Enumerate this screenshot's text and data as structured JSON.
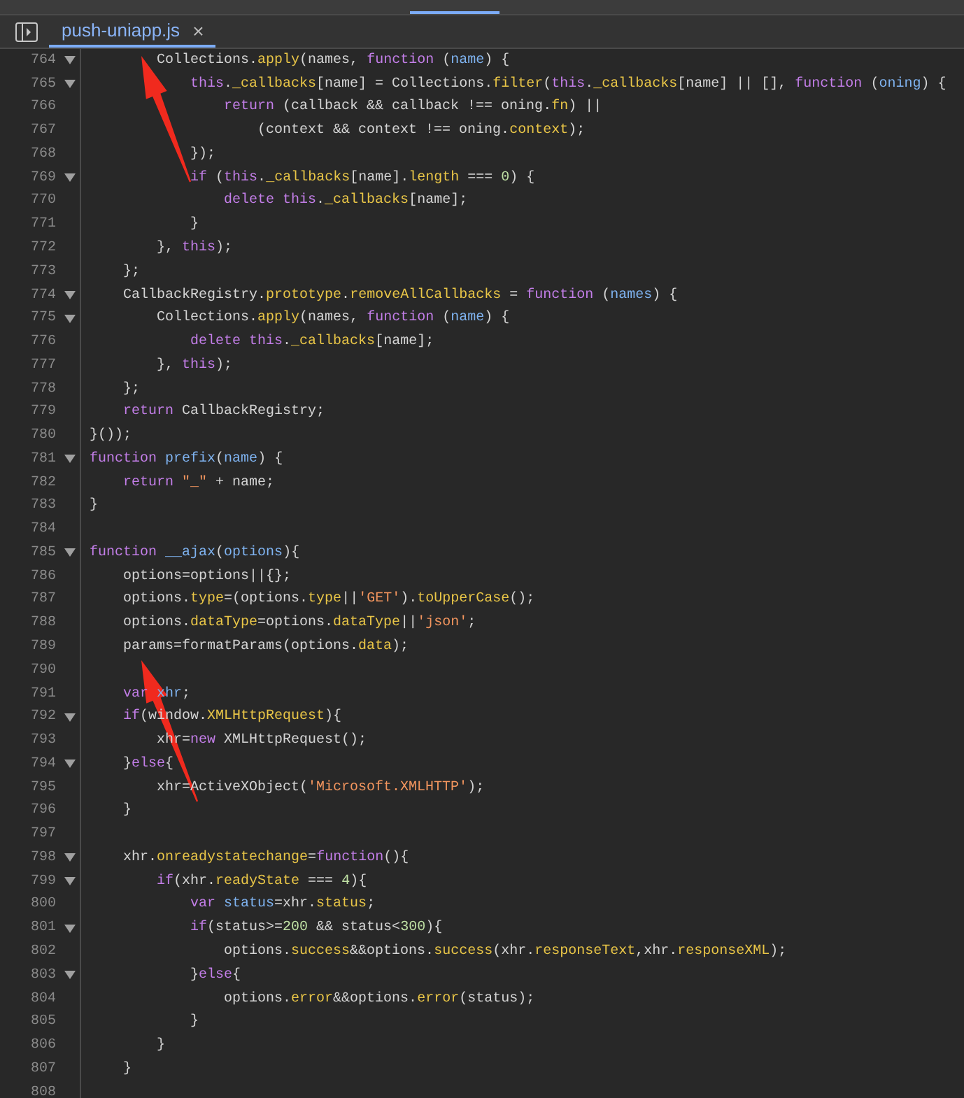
{
  "file_tab": {
    "label": "push-uniapp.js",
    "close": "×",
    "selected": true
  },
  "lines": [
    {
      "number": "764",
      "foldable": true,
      "tokens": [
        {
          "kind": "plain",
          "text": "        Collections."
        },
        {
          "kind": "property",
          "text": "apply"
        },
        {
          "kind": "plain",
          "text": "(names, "
        },
        {
          "kind": "keyword",
          "text": "function"
        },
        {
          "kind": "plain",
          "text": " ("
        },
        {
          "kind": "name",
          "text": "name"
        },
        {
          "kind": "plain",
          "text": ") {"
        }
      ]
    },
    {
      "number": "765",
      "foldable": true,
      "tokens": [
        {
          "kind": "keyword",
          "text": "            this"
        },
        {
          "kind": "plain",
          "text": "."
        },
        {
          "kind": "property",
          "text": "_callbacks"
        },
        {
          "kind": "plain",
          "text": "[name] = Collections."
        },
        {
          "kind": "property",
          "text": "filter"
        },
        {
          "kind": "plain",
          "text": "("
        },
        {
          "kind": "keyword",
          "text": "this"
        },
        {
          "kind": "plain",
          "text": "."
        },
        {
          "kind": "property",
          "text": "_callbacks"
        },
        {
          "kind": "plain",
          "text": "[name] || [], "
        },
        {
          "kind": "keyword",
          "text": "function"
        },
        {
          "kind": "plain",
          "text": " ("
        },
        {
          "kind": "name",
          "text": "oning"
        },
        {
          "kind": "plain",
          "text": ") {"
        }
      ]
    },
    {
      "number": "766",
      "foldable": false,
      "tokens": [
        {
          "kind": "keyword",
          "text": "                return"
        },
        {
          "kind": "plain",
          "text": " (callback && callback !== oning."
        },
        {
          "kind": "property",
          "text": "fn"
        },
        {
          "kind": "plain",
          "text": ") ||"
        }
      ]
    },
    {
      "number": "767",
      "foldable": false,
      "tokens": [
        {
          "kind": "plain",
          "text": "                    (context && context !== oning."
        },
        {
          "kind": "property",
          "text": "context"
        },
        {
          "kind": "plain",
          "text": ");"
        }
      ]
    },
    {
      "number": "768",
      "foldable": false,
      "tokens": [
        {
          "kind": "plain",
          "text": "            });"
        }
      ]
    },
    {
      "number": "769",
      "foldable": true,
      "tokens": [
        {
          "kind": "keyword",
          "text": "            if"
        },
        {
          "kind": "plain",
          "text": " ("
        },
        {
          "kind": "keyword",
          "text": "this"
        },
        {
          "kind": "plain",
          "text": "."
        },
        {
          "kind": "property",
          "text": "_callbacks"
        },
        {
          "kind": "plain",
          "text": "[name]."
        },
        {
          "kind": "property",
          "text": "length"
        },
        {
          "kind": "plain",
          "text": " === "
        },
        {
          "kind": "number",
          "text": "0"
        },
        {
          "kind": "plain",
          "text": ") {"
        }
      ]
    },
    {
      "number": "770",
      "foldable": false,
      "tokens": [
        {
          "kind": "keyword",
          "text": "                delete this"
        },
        {
          "kind": "plain",
          "text": "."
        },
        {
          "kind": "property",
          "text": "_callbacks"
        },
        {
          "kind": "plain",
          "text": "[name];"
        }
      ]
    },
    {
      "number": "771",
      "foldable": false,
      "tokens": [
        {
          "kind": "plain",
          "text": "            }"
        }
      ]
    },
    {
      "number": "772",
      "foldable": false,
      "tokens": [
        {
          "kind": "plain",
          "text": "        }, "
        },
        {
          "kind": "keyword",
          "text": "this"
        },
        {
          "kind": "plain",
          "text": ");"
        }
      ]
    },
    {
      "number": "773",
      "foldable": false,
      "tokens": [
        {
          "kind": "plain",
          "text": "    };"
        }
      ]
    },
    {
      "number": "774",
      "foldable": true,
      "tokens": [
        {
          "kind": "plain",
          "text": "    CallbackRegistry."
        },
        {
          "kind": "property",
          "text": "prototype"
        },
        {
          "kind": "plain",
          "text": "."
        },
        {
          "kind": "property",
          "text": "removeAllCallbacks"
        },
        {
          "kind": "plain",
          "text": " = "
        },
        {
          "kind": "keyword",
          "text": "function"
        },
        {
          "kind": "plain",
          "text": " ("
        },
        {
          "kind": "name",
          "text": "names"
        },
        {
          "kind": "plain",
          "text": ") {"
        }
      ]
    },
    {
      "number": "775",
      "foldable": true,
      "tokens": [
        {
          "kind": "plain",
          "text": "        Collections."
        },
        {
          "kind": "property",
          "text": "apply"
        },
        {
          "kind": "plain",
          "text": "(names, "
        },
        {
          "kind": "keyword",
          "text": "function"
        },
        {
          "kind": "plain",
          "text": " ("
        },
        {
          "kind": "name",
          "text": "name"
        },
        {
          "kind": "plain",
          "text": ") {"
        }
      ]
    },
    {
      "number": "776",
      "foldable": false,
      "tokens": [
        {
          "kind": "keyword",
          "text": "            delete this"
        },
        {
          "kind": "plain",
          "text": "."
        },
        {
          "kind": "property",
          "text": "_callbacks"
        },
        {
          "kind": "plain",
          "text": "[name];"
        }
      ]
    },
    {
      "number": "777",
      "foldable": false,
      "tokens": [
        {
          "kind": "plain",
          "text": "        }, "
        },
        {
          "kind": "keyword",
          "text": "this"
        },
        {
          "kind": "plain",
          "text": ");"
        }
      ]
    },
    {
      "number": "778",
      "foldable": false,
      "tokens": [
        {
          "kind": "plain",
          "text": "    };"
        }
      ]
    },
    {
      "number": "779",
      "foldable": false,
      "tokens": [
        {
          "kind": "keyword",
          "text": "    return"
        },
        {
          "kind": "plain",
          "text": " CallbackRegistry;"
        }
      ]
    },
    {
      "number": "780",
      "foldable": false,
      "tokens": [
        {
          "kind": "plain",
          "text": "}());"
        }
      ]
    },
    {
      "number": "781",
      "foldable": true,
      "tokens": [
        {
          "kind": "keyword",
          "text": "function "
        },
        {
          "kind": "name",
          "text": "prefix"
        },
        {
          "kind": "plain",
          "text": "("
        },
        {
          "kind": "name",
          "text": "name"
        },
        {
          "kind": "plain",
          "text": ") {"
        }
      ]
    },
    {
      "number": "782",
      "foldable": false,
      "tokens": [
        {
          "kind": "keyword",
          "text": "    return "
        },
        {
          "kind": "string",
          "text": "\"_\""
        },
        {
          "kind": "plain",
          "text": " + name;"
        }
      ]
    },
    {
      "number": "783",
      "foldable": false,
      "tokens": [
        {
          "kind": "plain",
          "text": "}"
        }
      ]
    },
    {
      "number": "784",
      "foldable": false
    },
    {
      "number": "785",
      "foldable": true,
      "tokens": [
        {
          "kind": "keyword",
          "text": "function "
        },
        {
          "kind": "name",
          "text": "__ajax"
        },
        {
          "kind": "plain",
          "text": "("
        },
        {
          "kind": "name",
          "text": "options"
        },
        {
          "kind": "plain",
          "text": "){"
        }
      ]
    },
    {
      "number": "786",
      "foldable": false,
      "tokens": [
        {
          "kind": "plain",
          "text": "    options=options||{};"
        }
      ]
    },
    {
      "number": "787",
      "foldable": false,
      "tokens": [
        {
          "kind": "plain",
          "text": "    options."
        },
        {
          "kind": "property",
          "text": "type"
        },
        {
          "kind": "plain",
          "text": "=(options."
        },
        {
          "kind": "property",
          "text": "type"
        },
        {
          "kind": "plain",
          "text": "||"
        },
        {
          "kind": "string",
          "text": "'GET'"
        },
        {
          "kind": "plain",
          "text": ")."
        },
        {
          "kind": "property",
          "text": "toUpperCase"
        },
        {
          "kind": "plain",
          "text": "();"
        }
      ]
    },
    {
      "number": "788",
      "foldable": false,
      "tokens": [
        {
          "kind": "plain",
          "text": "    options."
        },
        {
          "kind": "property",
          "text": "dataType"
        },
        {
          "kind": "plain",
          "text": "=options."
        },
        {
          "kind": "property",
          "text": "dataType"
        },
        {
          "kind": "plain",
          "text": "||"
        },
        {
          "kind": "string",
          "text": "'json'"
        },
        {
          "kind": "plain",
          "text": ";"
        }
      ]
    },
    {
      "number": "789",
      "foldable": false,
      "tokens": [
        {
          "kind": "plain",
          "text": "    params=formatParams(options."
        },
        {
          "kind": "property",
          "text": "data"
        },
        {
          "kind": "plain",
          "text": ");"
        }
      ]
    },
    {
      "number": "790",
      "foldable": false
    },
    {
      "number": "791",
      "foldable": false,
      "tokens": [
        {
          "kind": "keyword",
          "text": "    var "
        },
        {
          "kind": "name",
          "text": "xhr"
        },
        {
          "kind": "plain",
          "text": ";"
        }
      ]
    },
    {
      "number": "792",
      "foldable": true,
      "tokens": [
        {
          "kind": "keyword",
          "text": "    if"
        },
        {
          "kind": "plain",
          "text": "(window."
        },
        {
          "kind": "property",
          "text": "XMLHttpRequest"
        },
        {
          "kind": "plain",
          "text": "){"
        }
      ]
    },
    {
      "number": "793",
      "foldable": false,
      "tokens": [
        {
          "kind": "plain",
          "text": "        xhr="
        },
        {
          "kind": "keyword",
          "text": "new"
        },
        {
          "kind": "plain",
          "text": " XMLHttpRequest();"
        }
      ]
    },
    {
      "number": "794",
      "foldable": true,
      "tokens": [
        {
          "kind": "plain",
          "text": "    }"
        },
        {
          "kind": "keyword",
          "text": "else"
        },
        {
          "kind": "plain",
          "text": "{"
        }
      ]
    },
    {
      "number": "795",
      "foldable": false,
      "tokens": [
        {
          "kind": "plain",
          "text": "        xhr=ActiveXObject("
        },
        {
          "kind": "string",
          "text": "'Microsoft.XMLHTTP'"
        },
        {
          "kind": "plain",
          "text": ");"
        }
      ]
    },
    {
      "number": "796",
      "foldable": false,
      "tokens": [
        {
          "kind": "plain",
          "text": "    }"
        }
      ]
    },
    {
      "number": "797",
      "foldable": false
    },
    {
      "number": "798",
      "foldable": true,
      "tokens": [
        {
          "kind": "plain",
          "text": "    xhr."
        },
        {
          "kind": "property",
          "text": "onreadystatechange"
        },
        {
          "kind": "plain",
          "text": "="
        },
        {
          "kind": "keyword",
          "text": "function"
        },
        {
          "kind": "plain",
          "text": "(){"
        }
      ]
    },
    {
      "number": "799",
      "foldable": true,
      "tokens": [
        {
          "kind": "keyword",
          "text": "        if"
        },
        {
          "kind": "plain",
          "text": "(xhr."
        },
        {
          "kind": "property",
          "text": "readyState"
        },
        {
          "kind": "plain",
          "text": " === "
        },
        {
          "kind": "number",
          "text": "4"
        },
        {
          "kind": "plain",
          "text": "){"
        }
      ]
    },
    {
      "number": "800",
      "foldable": false,
      "tokens": [
        {
          "kind": "keyword",
          "text": "            var "
        },
        {
          "kind": "name",
          "text": "status"
        },
        {
          "kind": "plain",
          "text": "=xhr."
        },
        {
          "kind": "property",
          "text": "status"
        },
        {
          "kind": "plain",
          "text": ";"
        }
      ]
    },
    {
      "number": "801",
      "foldable": true,
      "tokens": [
        {
          "kind": "keyword",
          "text": "            if"
        },
        {
          "kind": "plain",
          "text": "(status>="
        },
        {
          "kind": "number",
          "text": "200"
        },
        {
          "kind": "plain",
          "text": " && status<"
        },
        {
          "kind": "number",
          "text": "300"
        },
        {
          "kind": "plain",
          "text": "){"
        }
      ]
    },
    {
      "number": "802",
      "foldable": false,
      "tokens": [
        {
          "kind": "plain",
          "text": "                options."
        },
        {
          "kind": "property",
          "text": "success"
        },
        {
          "kind": "plain",
          "text": "&&options."
        },
        {
          "kind": "property",
          "text": "success"
        },
        {
          "kind": "plain",
          "text": "(xhr."
        },
        {
          "kind": "property",
          "text": "responseText"
        },
        {
          "kind": "plain",
          "text": ",xhr."
        },
        {
          "kind": "property",
          "text": "responseXML"
        },
        {
          "kind": "plain",
          "text": ");"
        }
      ]
    },
    {
      "number": "803",
      "foldable": true,
      "tokens": [
        {
          "kind": "plain",
          "text": "            }"
        },
        {
          "kind": "keyword",
          "text": "else"
        },
        {
          "kind": "plain",
          "text": "{"
        }
      ]
    },
    {
      "number": "804",
      "foldable": false,
      "tokens": [
        {
          "kind": "plain",
          "text": "                options."
        },
        {
          "kind": "property",
          "text": "error"
        },
        {
          "kind": "plain",
          "text": "&&options."
        },
        {
          "kind": "property",
          "text": "error"
        },
        {
          "kind": "plain",
          "text": "(status);"
        }
      ]
    },
    {
      "number": "805",
      "foldable": false,
      "tokens": [
        {
          "kind": "plain",
          "text": "            }"
        }
      ]
    },
    {
      "number": "806",
      "foldable": false,
      "tokens": [
        {
          "kind": "plain",
          "text": "        }"
        }
      ]
    },
    {
      "number": "807",
      "foldable": false,
      "tokens": [
        {
          "kind": "plain",
          "text": "    }"
        }
      ]
    },
    {
      "number": "808",
      "foldable": false
    }
  ]
}
